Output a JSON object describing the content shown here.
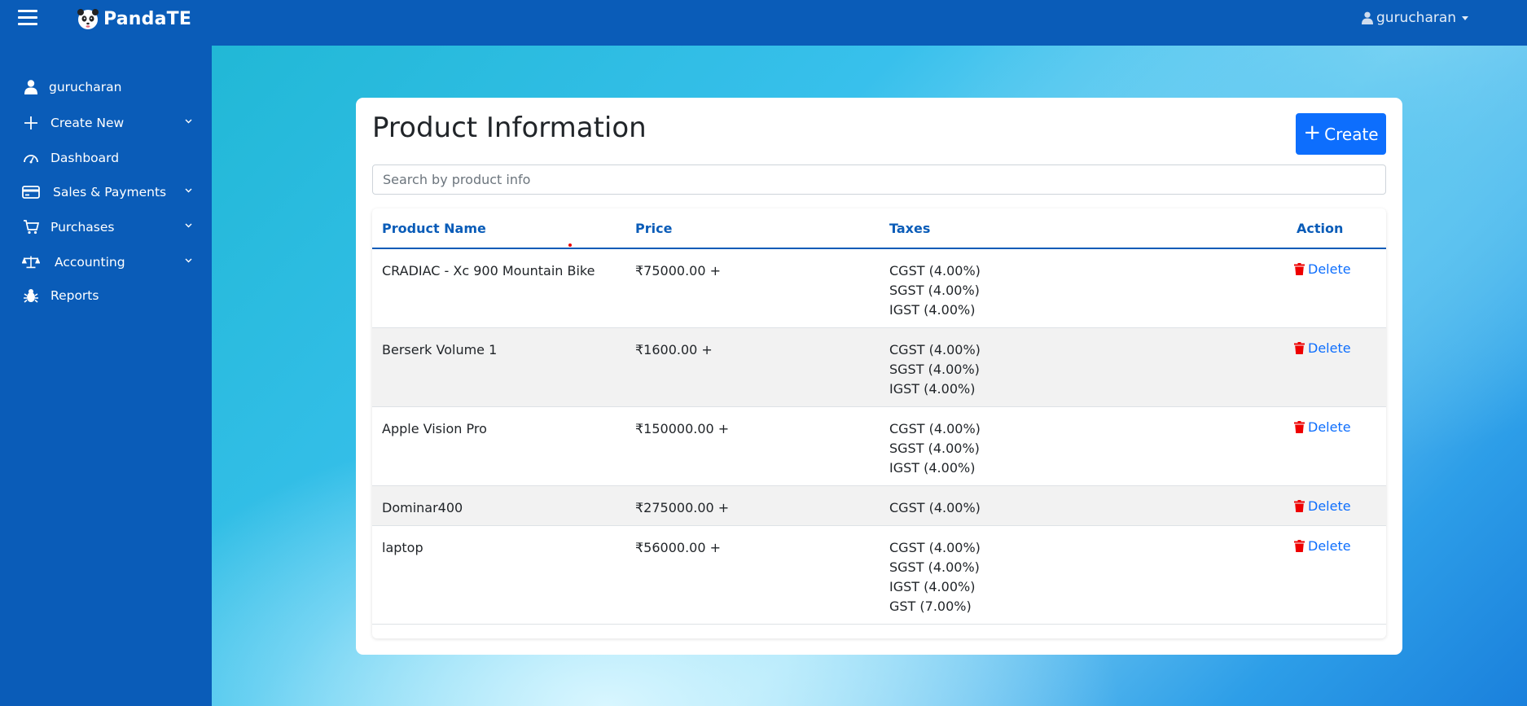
{
  "app": {
    "name": "PandaTE"
  },
  "header": {
    "username": "gurucharan"
  },
  "sidebar": {
    "items": [
      {
        "label": "gurucharan",
        "icon": "user-icon"
      },
      {
        "label": "Create New",
        "icon": "plus-icon"
      },
      {
        "label": "Dashboard",
        "icon": "gauge-icon"
      },
      {
        "label": "Sales & Payments",
        "icon": "credit-card-icon"
      },
      {
        "label": "Purchases",
        "icon": "cart-icon"
      },
      {
        "label": "Accounting",
        "icon": "balance-scale-icon"
      },
      {
        "label": "Reports",
        "icon": "bug-icon"
      }
    ]
  },
  "page": {
    "title": "Product Information",
    "create_label": "Create",
    "search_placeholder": "Search by product info"
  },
  "table": {
    "headers": [
      "Product Name",
      "Price",
      "Taxes",
      "Action"
    ],
    "rows": [
      {
        "name": "CRADIAC - Xc 900 Mountain Bike",
        "price": "₹75000.00 +",
        "taxes": [
          "CGST (4.00%)",
          "SGST (4.00%)",
          "IGST (4.00%)"
        ],
        "action": "Delete"
      },
      {
        "name": "Berserk Volume 1",
        "price": "₹1600.00 +",
        "taxes": [
          "CGST (4.00%)",
          "SGST (4.00%)",
          "IGST (4.00%)"
        ],
        "action": "Delete"
      },
      {
        "name": "Apple Vision Pro",
        "price": "₹150000.00 +",
        "taxes": [
          "CGST (4.00%)",
          "SGST (4.00%)",
          "IGST (4.00%)"
        ],
        "action": "Delete"
      },
      {
        "name": "Dominar400",
        "price": "₹275000.00 +",
        "taxes": [
          "CGST (4.00%)"
        ],
        "action": "Delete"
      },
      {
        "name": "laptop",
        "price": "₹56000.00 +",
        "taxes": [
          "CGST (4.00%)",
          "SGST (4.00%)",
          "IGST (4.00%)",
          "GST (7.00%)"
        ],
        "action": "Delete"
      }
    ]
  },
  "colors": {
    "primary": "#0a5cb8",
    "button": "#0d6efd",
    "delete_icon": "#e00000"
  }
}
